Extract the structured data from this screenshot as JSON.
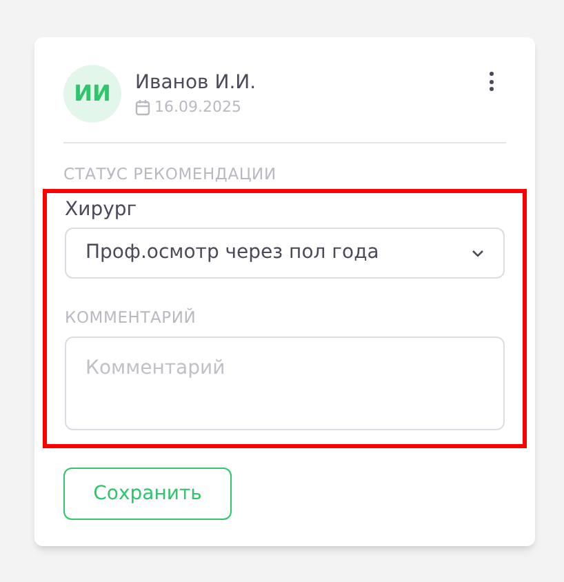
{
  "patient": {
    "initials": "ИИ",
    "name": "Иванов И.И.",
    "date": "16.09.2025"
  },
  "section_title": "СТАТУС РЕКОМЕНДАЦИИ",
  "highlighted": true,
  "specialist": {
    "label": "Хирург",
    "value": "Проф.осмотр через пол года"
  },
  "comment": {
    "label": "КОММЕНТАРИЙ",
    "placeholder": "Комментарий"
  },
  "save_button": "Сохранить"
}
